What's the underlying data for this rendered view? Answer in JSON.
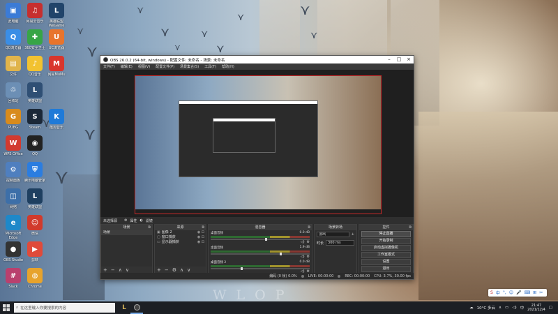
{
  "desktop": {
    "icons": [
      {
        "label": "此电脑",
        "glyph": "▣",
        "color": "#3b7bd6",
        "col": 0,
        "row": 0
      },
      {
        "label": "QQ浏览器",
        "glyph": "Q",
        "color": "#3a8ee6",
        "col": 0,
        "row": 1
      },
      {
        "label": "文件",
        "glyph": "▤",
        "color": "#e0b44b",
        "col": 0,
        "row": 2
      },
      {
        "label": "回收站",
        "glyph": "♲",
        "color": "#6c8fb5",
        "col": 0,
        "row": 3
      },
      {
        "label": "PUBG",
        "glyph": "G",
        "color": "#d88b1d",
        "col": 0,
        "row": 4
      },
      {
        "label": "WPS Office",
        "glyph": "W",
        "color": "#d23a2f",
        "col": 0,
        "row": 5
      },
      {
        "label": "控制面板",
        "glyph": "⚙",
        "color": "#4f7fbf",
        "col": 0,
        "row": 6
      },
      {
        "label": "网络",
        "glyph": "◫",
        "color": "#3d6fa8",
        "col": 0,
        "row": 7
      },
      {
        "label": "Microsoft Edge",
        "glyph": "e",
        "color": "#1e88c9",
        "col": 0,
        "row": 8
      },
      {
        "label": "OBS Studio",
        "glyph": "●",
        "color": "#333333",
        "col": 0,
        "row": 9
      },
      {
        "label": "Slack",
        "glyph": "#",
        "color": "#b9406e",
        "col": 0,
        "row": 10
      },
      {
        "label": "网易云音乐",
        "glyph": "♫",
        "color": "#c62f2f",
        "col": 1,
        "row": 0
      },
      {
        "label": "360安全卫士",
        "glyph": "✚",
        "color": "#37a546",
        "col": 1,
        "row": 1
      },
      {
        "label": "QQ音乐",
        "glyph": "♪",
        "color": "#f2c230",
        "col": 1,
        "row": 2
      },
      {
        "label": "英雄联盟",
        "glyph": "L",
        "color": "#2f4f74",
        "col": 1,
        "row": 3
      },
      {
        "label": "Steam",
        "glyph": "S",
        "color": "#1b2838",
        "col": 1,
        "row": 4
      },
      {
        "label": "QQ",
        "glyph": "◉",
        "color": "#222222",
        "col": 1,
        "row": 5
      },
      {
        "label": "腾讯电脑管家",
        "glyph": "⛨",
        "color": "#2b7de0",
        "col": 1,
        "row": 6
      },
      {
        "label": "英雄联盟",
        "glyph": "L",
        "color": "#1e3f60",
        "col": 1,
        "row": 7
      },
      {
        "label": "微信",
        "glyph": "☺",
        "color": "#d13a2c",
        "col": 1,
        "row": 8
      },
      {
        "label": "剪映",
        "glyph": "▶",
        "color": "#e04a3a",
        "col": 1,
        "row": 9
      },
      {
        "label": "Chrome",
        "glyph": "◍",
        "color": "#e7a32c",
        "col": 1,
        "row": 10
      },
      {
        "label": "英雄联盟WeGame",
        "glyph": "L",
        "color": "#21446a",
        "col": 2,
        "row": 0
      },
      {
        "label": "UC浏览器",
        "glyph": "U",
        "color": "#e8742c",
        "col": 2,
        "row": 1
      },
      {
        "label": "网易MuMu",
        "glyph": "M",
        "color": "#d9362d",
        "col": 2,
        "row": 2
      },
      {
        "label": "酷狗音乐",
        "glyph": "K",
        "color": "#1f7ad8",
        "col": 2,
        "row": 4
      }
    ],
    "watermark": "WLOP"
  },
  "obs": {
    "title": "OBS 26.0.2 (64-bit, windows) - 配置文件: 未命名 - 场景: 未命名",
    "menu": [
      "文件(F)",
      "编辑(E)",
      "视图(V)",
      "配置文件(P)",
      "场景集合(S)",
      "工具(T)",
      "帮助(H)"
    ],
    "statusline": {
      "scene_label": "未选择源",
      "props": "属性",
      "filters": "滤镜"
    },
    "scenes": {
      "title": "场景",
      "items": [
        "场景"
      ]
    },
    "sources": {
      "title": "来源",
      "items": [
        {
          "name": "图像 2",
          "icon": "▣"
        },
        {
          "name": "窗口捕获",
          "icon": "▢"
        },
        {
          "name": "显示器捕获",
          "icon": "▭"
        }
      ]
    },
    "mixer": {
      "title": "混音器",
      "channels": [
        {
          "name": "桌面音频",
          "db": "0.0 dB",
          "level": 0.55
        },
        {
          "name": "桌面音频",
          "db": "1.9 dB",
          "level": 0.7
        },
        {
          "name": "桌面音频 2",
          "db": "0.0 dB",
          "level": 0.3
        }
      ]
    },
    "transitions": {
      "title": "场景转场",
      "selected": "淡出",
      "duration_label": "时长",
      "duration": "300 ms"
    },
    "controls": {
      "title": "控件",
      "buttons": [
        "停止直播",
        "开始录制",
        "启动虚拟摄像机",
        "工作室模式",
        "设置",
        "退出"
      ]
    },
    "status": {
      "live": "LIVE: 00:00:00",
      "rec": "REC: 00:00:00",
      "cpu": "CPU: 3.7%, 30.00 fps",
      "fps": "60.00 fps",
      "dropped": "编码 (0 帧) 0.0%"
    }
  },
  "taskbar": {
    "search_placeholder": "在这里输入你要搜索的内容",
    "weather": "10°C 多云",
    "time": "21:47",
    "date": "2021/12/4",
    "ime": [
      "S",
      "中",
      "°,",
      "☺",
      "🎤",
      "⌨",
      "⊞",
      "✂"
    ]
  }
}
